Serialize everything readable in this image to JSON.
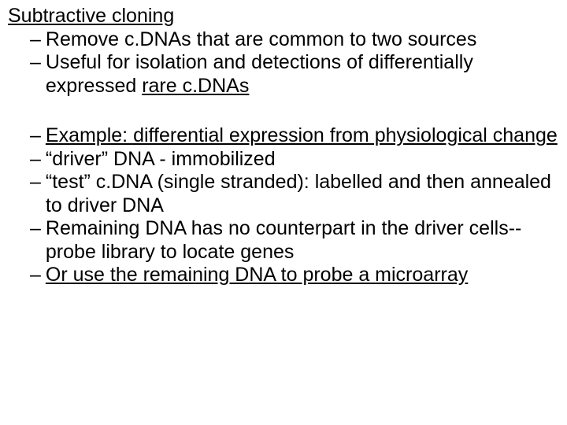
{
  "title": "Subtractive cloning",
  "group1": [
    {
      "pre": "Remove c.DNAs that are common to two sources",
      "u": "",
      "post": ""
    },
    {
      "pre": "Useful for isolation and detections of differentially expressed ",
      "u": "rare c.DNAs",
      "post": ""
    }
  ],
  "group2": [
    {
      "pre": "",
      "u": "Example: differential expression from physiological change",
      "post": ""
    },
    {
      "pre": "“driver” DNA - immobilized",
      "u": "",
      "post": ""
    },
    {
      "pre": "“test” c.DNA (single stranded): labelled and then annealed to driver DNA",
      "u": "",
      "post": ""
    },
    {
      "pre": "Remaining DNA has no counterpart in the driver cells--probe library to locate genes",
      "u": "",
      "post": ""
    },
    {
      "pre": "",
      "u": "Or use the remaining DNA to probe a microarray",
      "post": ""
    }
  ],
  "dash": "–"
}
